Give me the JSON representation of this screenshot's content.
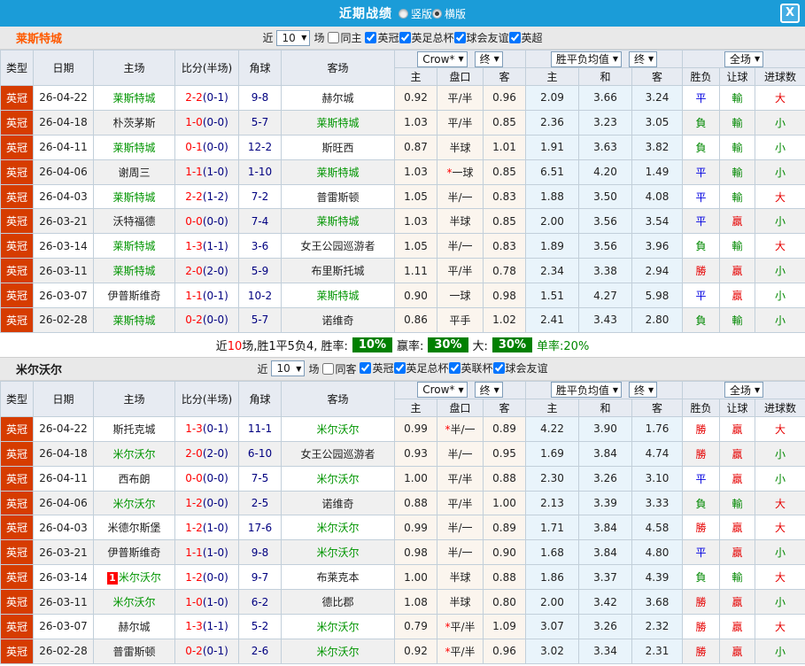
{
  "titlebar": {
    "title": "近期战绩",
    "layout_options": [
      {
        "label": "竖版",
        "selected": false
      },
      {
        "label": "横版",
        "selected": true
      }
    ],
    "close_label": "X"
  },
  "table_header": {
    "type": "类型",
    "date": "日期",
    "home": "主场",
    "score": "比分(半场)",
    "corner": "角球",
    "away": "客场",
    "asian_book": "Crow*",
    "asian_time": "终",
    "euro_book": "胜平负均值",
    "euro_time": "终",
    "scope": "全场",
    "sub_home": "主",
    "sub_handicap": "盘口",
    "sub_away": "客",
    "sub_euro_home": "主",
    "sub_euro_draw": "和",
    "sub_euro_away": "客",
    "sub_result": "胜负",
    "sub_let": "让球",
    "sub_goals": "进球数"
  },
  "colors": {
    "titlebar_blue": "#1b9cd8",
    "league_badge": "#d63c00",
    "team_highlight_green": "#009500",
    "score_red": "#ff0000",
    "halftime_navy": "#000080",
    "asian_col_cream": "#fbf5ee",
    "euro_col_blue": "#e9f4fb",
    "summary_green": "#008000"
  },
  "sections": [
    {
      "team": "莱斯特城",
      "filter": {
        "prefix": "近",
        "count": "10",
        "suffix": "场",
        "same_label": "同主",
        "same_checked": false,
        "leagues": [
          {
            "label": "英冠",
            "checked": true
          },
          {
            "label": "英足总杯",
            "checked": true
          },
          {
            "label": "球会友谊",
            "checked": true
          },
          {
            "label": "英超",
            "checked": true
          }
        ]
      },
      "rows": [
        {
          "league": "英冠",
          "date": "26-04-22",
          "home": "莱斯特城",
          "home_badge": "",
          "home_is_team": true,
          "score": "2-2",
          "half": "(0-1)",
          "corner": "9-8",
          "away": "赫尔城",
          "away_is_team": false,
          "asian_home": "0.92",
          "handicap": "平/半",
          "asian_away": "0.96",
          "euro_home": "2.09",
          "euro_draw": "3.66",
          "euro_away": "3.24",
          "result": "平",
          "let": "輸",
          "goals": "大"
        },
        {
          "league": "英冠",
          "date": "26-04-18",
          "home": "朴茨茅斯",
          "home_badge": "",
          "home_is_team": false,
          "score": "1-0",
          "half": "(0-0)",
          "corner": "5-7",
          "away": "莱斯特城",
          "away_is_team": true,
          "asian_home": "1.03",
          "handicap": "平/半",
          "asian_away": "0.85",
          "euro_home": "2.36",
          "euro_draw": "3.23",
          "euro_away": "3.05",
          "result": "負",
          "let": "輸",
          "goals": "小"
        },
        {
          "league": "英冠",
          "date": "26-04-11",
          "home": "莱斯特城",
          "home_badge": "",
          "home_is_team": true,
          "score": "0-1",
          "half": "(0-0)",
          "corner": "12-2",
          "away": "斯旺西",
          "away_is_team": false,
          "asian_home": "0.87",
          "handicap": "半球",
          "asian_away": "1.01",
          "euro_home": "1.91",
          "euro_draw": "3.63",
          "euro_away": "3.82",
          "result": "負",
          "let": "輸",
          "goals": "小"
        },
        {
          "league": "英冠",
          "date": "26-04-06",
          "home": "谢周三",
          "home_badge": "",
          "home_is_team": false,
          "score": "1-1",
          "half": "(1-0)",
          "corner": "1-10",
          "away": "莱斯特城",
          "away_is_team": true,
          "asian_home": "1.03",
          "handicap": "*一球",
          "asian_away": "0.85",
          "euro_home": "6.51",
          "euro_draw": "4.20",
          "euro_away": "1.49",
          "result": "平",
          "let": "輸",
          "goals": "小"
        },
        {
          "league": "英冠",
          "date": "26-04-03",
          "home": "莱斯特城",
          "home_badge": "",
          "home_is_team": true,
          "score": "2-2",
          "half": "(1-2)",
          "corner": "7-2",
          "away": "普雷斯顿",
          "away_is_team": false,
          "asian_home": "1.05",
          "handicap": "半/一",
          "asian_away": "0.83",
          "euro_home": "1.88",
          "euro_draw": "3.50",
          "euro_away": "4.08",
          "result": "平",
          "let": "輸",
          "goals": "大"
        },
        {
          "league": "英冠",
          "date": "26-03-21",
          "home": "沃特福德",
          "home_badge": "",
          "home_is_team": false,
          "score": "0-0",
          "half": "(0-0)",
          "corner": "7-4",
          "away": "莱斯特城",
          "away_is_team": true,
          "asian_home": "1.03",
          "handicap": "半球",
          "asian_away": "0.85",
          "euro_home": "2.00",
          "euro_draw": "3.56",
          "euro_away": "3.54",
          "result": "平",
          "let": "贏",
          "goals": "小"
        },
        {
          "league": "英冠",
          "date": "26-03-14",
          "home": "莱斯特城",
          "home_badge": "",
          "home_is_team": true,
          "score": "1-3",
          "half": "(1-1)",
          "corner": "3-6",
          "away": "女王公园巡游者",
          "away_is_team": false,
          "asian_home": "1.05",
          "handicap": "半/一",
          "asian_away": "0.83",
          "euro_home": "1.89",
          "euro_draw": "3.56",
          "euro_away": "3.96",
          "result": "負",
          "let": "輸",
          "goals": "大"
        },
        {
          "league": "英冠",
          "date": "26-03-11",
          "home": "莱斯特城",
          "home_badge": "",
          "home_is_team": true,
          "score": "2-0",
          "half": "(2-0)",
          "corner": "5-9",
          "away": "布里斯托城",
          "away_is_team": false,
          "asian_home": "1.11",
          "handicap": "平/半",
          "asian_away": "0.78",
          "euro_home": "2.34",
          "euro_draw": "3.38",
          "euro_away": "2.94",
          "result": "勝",
          "let": "贏",
          "goals": "小"
        },
        {
          "league": "英冠",
          "date": "26-03-07",
          "home": "伊普斯维奇",
          "home_badge": "",
          "home_is_team": false,
          "score": "1-1",
          "half": "(0-1)",
          "corner": "10-2",
          "away": "莱斯特城",
          "away_is_team": true,
          "asian_home": "0.90",
          "handicap": "一球",
          "asian_away": "0.98",
          "euro_home": "1.51",
          "euro_draw": "4.27",
          "euro_away": "5.98",
          "result": "平",
          "let": "贏",
          "goals": "小"
        },
        {
          "league": "英冠",
          "date": "26-02-28",
          "home": "莱斯特城",
          "home_badge": "",
          "home_is_team": true,
          "score": "0-2",
          "half": "(0-0)",
          "corner": "5-7",
          "away": "诺维奇",
          "away_is_team": false,
          "asian_home": "0.86",
          "handicap": "平手",
          "asian_away": "1.02",
          "euro_home": "2.41",
          "euro_draw": "3.43",
          "euro_away": "2.80",
          "result": "負",
          "let": "輸",
          "goals": "小"
        }
      ],
      "summary": {
        "prefix": "近",
        "count": "10",
        "record": "场,胜1平5负4, 胜率:",
        "win_rate": "10%",
        "profit_label": "赢率:",
        "profit_rate": "30%",
        "big_label": "大:",
        "big_rate": "30%",
        "single_label": "单率:20%"
      }
    },
    {
      "team": "米尔沃尔",
      "filter": {
        "prefix": "近",
        "count": "10",
        "suffix": "场",
        "same_label": "同客",
        "same_checked": false,
        "leagues": [
          {
            "label": "英冠",
            "checked": true
          },
          {
            "label": "英足总杯",
            "checked": true
          },
          {
            "label": "英联杯",
            "checked": true
          },
          {
            "label": "球会友谊",
            "checked": true
          }
        ]
      },
      "rows": [
        {
          "league": "英冠",
          "date": "26-04-22",
          "home": "斯托克城",
          "home_badge": "",
          "home_is_team": false,
          "score": "1-3",
          "half": "(0-1)",
          "corner": "11-1",
          "away": "米尔沃尔",
          "away_is_team": true,
          "asian_home": "0.99",
          "handicap": "*半/一",
          "asian_away": "0.89",
          "euro_home": "4.22",
          "euro_draw": "3.90",
          "euro_away": "1.76",
          "result": "勝",
          "let": "贏",
          "goals": "大"
        },
        {
          "league": "英冠",
          "date": "26-04-18",
          "home": "米尔沃尔",
          "home_badge": "",
          "home_is_team": true,
          "score": "2-0",
          "half": "(2-0)",
          "corner": "6-10",
          "away": "女王公园巡游者",
          "away_is_team": false,
          "asian_home": "0.93",
          "handicap": "半/一",
          "asian_away": "0.95",
          "euro_home": "1.69",
          "euro_draw": "3.84",
          "euro_away": "4.74",
          "result": "勝",
          "let": "贏",
          "goals": "小"
        },
        {
          "league": "英冠",
          "date": "26-04-11",
          "home": "西布朗",
          "home_badge": "",
          "home_is_team": false,
          "score": "0-0",
          "half": "(0-0)",
          "corner": "7-5",
          "away": "米尔沃尔",
          "away_is_team": true,
          "asian_home": "1.00",
          "handicap": "平/半",
          "asian_away": "0.88",
          "euro_home": "2.30",
          "euro_draw": "3.26",
          "euro_away": "3.10",
          "result": "平",
          "let": "贏",
          "goals": "小"
        },
        {
          "league": "英冠",
          "date": "26-04-06",
          "home": "米尔沃尔",
          "home_badge": "",
          "home_is_team": true,
          "score": "1-2",
          "half": "(0-0)",
          "corner": "2-5",
          "away": "诺维奇",
          "away_is_team": false,
          "asian_home": "0.88",
          "handicap": "平/半",
          "asian_away": "1.00",
          "euro_home": "2.13",
          "euro_draw": "3.39",
          "euro_away": "3.33",
          "result": "負",
          "let": "輸",
          "goals": "大"
        },
        {
          "league": "英冠",
          "date": "26-04-03",
          "home": "米德尔斯堡",
          "home_badge": "",
          "home_is_team": false,
          "score": "1-2",
          "half": "(1-0)",
          "corner": "17-6",
          "away": "米尔沃尔",
          "away_is_team": true,
          "asian_home": "0.99",
          "handicap": "半/一",
          "asian_away": "0.89",
          "euro_home": "1.71",
          "euro_draw": "3.84",
          "euro_away": "4.58",
          "result": "勝",
          "let": "贏",
          "goals": "大"
        },
        {
          "league": "英冠",
          "date": "26-03-21",
          "home": "伊普斯维奇",
          "home_badge": "",
          "home_is_team": false,
          "score": "1-1",
          "half": "(1-0)",
          "corner": "9-8",
          "away": "米尔沃尔",
          "away_is_team": true,
          "asian_home": "0.98",
          "handicap": "半/一",
          "asian_away": "0.90",
          "euro_home": "1.68",
          "euro_draw": "3.84",
          "euro_away": "4.80",
          "result": "平",
          "let": "贏",
          "goals": "小"
        },
        {
          "league": "英冠",
          "date": "26-03-14",
          "home": "米尔沃尔",
          "home_badge": "1",
          "home_is_team": true,
          "score": "1-2",
          "half": "(0-0)",
          "corner": "9-7",
          "away": "布莱克本",
          "away_is_team": false,
          "asian_home": "1.00",
          "handicap": "半球",
          "asian_away": "0.88",
          "euro_home": "1.86",
          "euro_draw": "3.37",
          "euro_away": "4.39",
          "result": "負",
          "let": "輸",
          "goals": "大"
        },
        {
          "league": "英冠",
          "date": "26-03-11",
          "home": "米尔沃尔",
          "home_badge": "",
          "home_is_team": true,
          "score": "1-0",
          "half": "(1-0)",
          "corner": "6-2",
          "away": "德比郡",
          "away_is_team": false,
          "asian_home": "1.08",
          "handicap": "半球",
          "asian_away": "0.80",
          "euro_home": "2.00",
          "euro_draw": "3.42",
          "euro_away": "3.68",
          "result": "勝",
          "let": "贏",
          "goals": "小"
        },
        {
          "league": "英冠",
          "date": "26-03-07",
          "home": "赫尔城",
          "home_badge": "",
          "home_is_team": false,
          "score": "1-3",
          "half": "(1-1)",
          "corner": "5-2",
          "away": "米尔沃尔",
          "away_is_team": true,
          "asian_home": "0.79",
          "handicap": "*平/半",
          "asian_away": "1.09",
          "euro_home": "3.07",
          "euro_draw": "3.26",
          "euro_away": "2.32",
          "result": "勝",
          "let": "贏",
          "goals": "大"
        },
        {
          "league": "英冠",
          "date": "26-02-28",
          "home": "普雷斯顿",
          "home_badge": "",
          "home_is_team": false,
          "score": "0-2",
          "half": "(0-1)",
          "corner": "2-6",
          "away": "米尔沃尔",
          "away_is_team": true,
          "asian_home": "0.92",
          "handicap": "*平/半",
          "asian_away": "0.96",
          "euro_home": "3.02",
          "euro_draw": "3.34",
          "euro_away": "2.31",
          "result": "勝",
          "let": "贏",
          "goals": "小"
        }
      ]
    }
  ]
}
